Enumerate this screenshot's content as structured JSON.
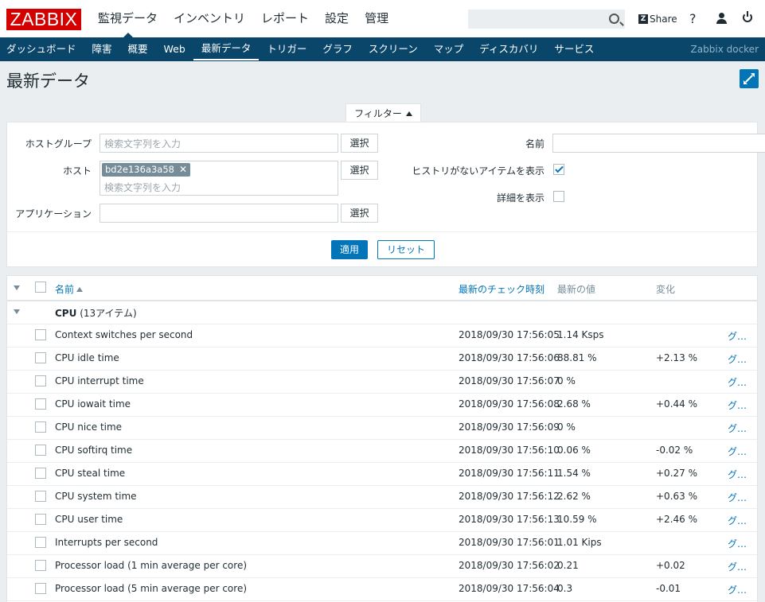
{
  "header": {
    "logo": "ZABBIX",
    "main_menu": [
      "監視データ",
      "インベントリ",
      "レポート",
      "設定",
      "管理"
    ],
    "share_label": "Share",
    "help_label": "?"
  },
  "subnav": {
    "items": [
      "ダッシュボード",
      "障害",
      "概要",
      "Web",
      "最新データ",
      "トリガー",
      "グラフ",
      "スクリーン",
      "マップ",
      "ディスカバリ",
      "サービス"
    ],
    "active": "最新データ",
    "server_name": "Zabbix docker"
  },
  "page": {
    "title": "最新データ"
  },
  "filter": {
    "tab_label": "フィルター",
    "host_group_label": "ホストグループ",
    "host_group_placeholder": "検索文字列を入力",
    "host_label": "ホスト",
    "host_tag": "bd2e136a3a58",
    "host_placeholder": "検索文字列を入力",
    "application_label": "アプリケーション",
    "application_value": "",
    "select_label": "選択",
    "name_label": "名前",
    "name_value": "",
    "show_no_history_label": "ヒストリがないアイテムを表示",
    "show_no_history_checked": true,
    "show_details_label": "詳細を表示",
    "show_details_checked": false,
    "apply_label": "適用",
    "reset_label": "リセット"
  },
  "table": {
    "headers": {
      "name": "名前",
      "last_check": "最新のチェック時刻",
      "last_value": "最新の値",
      "change": "変化"
    },
    "group": {
      "name": "CPU",
      "count": "(13アイテム)"
    },
    "graph_label": "グ…",
    "rows": [
      {
        "name": "Context switches per second",
        "time": "2018/09/30 17:56:05",
        "value": "1.14 Ksps",
        "change": ""
      },
      {
        "name": "CPU idle time",
        "time": "2018/09/30 17:56:06",
        "value": "88.81 %",
        "change": "+2.13 %"
      },
      {
        "name": "CPU interrupt time",
        "time": "2018/09/30 17:56:07",
        "value": "0 %",
        "change": ""
      },
      {
        "name": "CPU iowait time",
        "time": "2018/09/30 17:56:08",
        "value": "2.68 %",
        "change": "+0.44 %"
      },
      {
        "name": "CPU nice time",
        "time": "2018/09/30 17:56:09",
        "value": "0 %",
        "change": ""
      },
      {
        "name": "CPU softirq time",
        "time": "2018/09/30 17:56:10",
        "value": "0.06 %",
        "change": "-0.02 %"
      },
      {
        "name": "CPU steal time",
        "time": "2018/09/30 17:56:11",
        "value": "1.54 %",
        "change": "+0.27 %"
      },
      {
        "name": "CPU system time",
        "time": "2018/09/30 17:56:12",
        "value": "2.62 %",
        "change": "+0.63 %"
      },
      {
        "name": "CPU user time",
        "time": "2018/09/30 17:56:13",
        "value": "10.59 %",
        "change": "+2.46 %"
      },
      {
        "name": "Interrupts per second",
        "time": "2018/09/30 17:56:01",
        "value": "1.01 Kips",
        "change": ""
      },
      {
        "name": "Processor load (1 min average per core)",
        "time": "2018/09/30 17:56:02",
        "value": "0.21",
        "change": "+0.02"
      },
      {
        "name": "Processor load (5 min average per core)",
        "time": "2018/09/30 17:56:04",
        "value": "0.3",
        "change": "-0.01"
      }
    ]
  }
}
